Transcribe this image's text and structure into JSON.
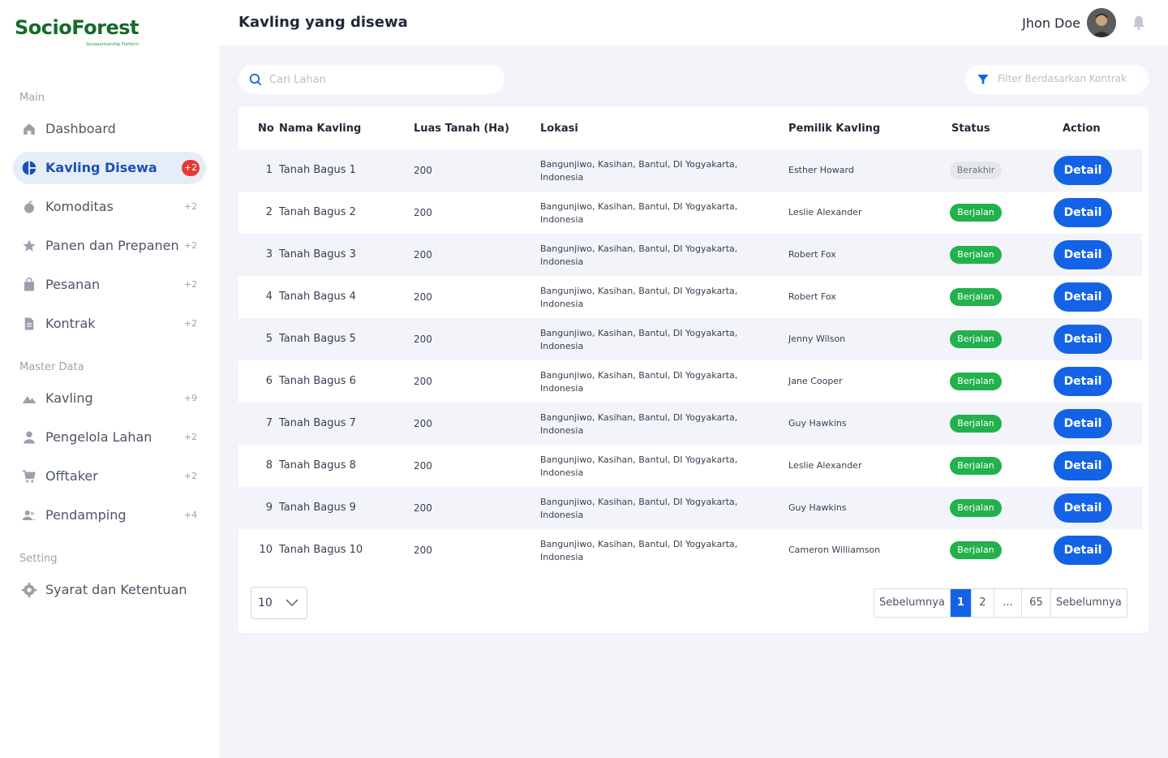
{
  "brand": {
    "name": "SocioForest",
    "tagline": "Sociopartnership Platform",
    "color": "#166b2a"
  },
  "sidebar": {
    "sections": [
      {
        "label": "Main"
      },
      {
        "label": "Master Data"
      },
      {
        "label": "Setting"
      }
    ],
    "items": [
      {
        "label": "Dashboard",
        "badge": "",
        "icon": "home-icon"
      },
      {
        "label": "Kavling Disewa",
        "badge": "+2",
        "icon": "pie-chart-icon",
        "active": true
      },
      {
        "label": "Komoditas",
        "badge": "+2",
        "icon": "fruit-icon"
      },
      {
        "label": "Panen dan Prepanen",
        "badge": "+2",
        "icon": "star-icon"
      },
      {
        "label": "Pesanan",
        "badge": "+2",
        "icon": "shopping-bag-icon"
      },
      {
        "label": "Kontrak",
        "badge": "+2",
        "icon": "document-icon"
      },
      {
        "label": "Kavling",
        "badge": "+9",
        "icon": "landscape-icon"
      },
      {
        "label": "Pengelola Lahan",
        "badge": "+2",
        "icon": "user-icon"
      },
      {
        "label": "Offtaker",
        "badge": "+2",
        "icon": "cart-icon"
      },
      {
        "label": "Pendamping",
        "badge": "+4",
        "icon": "users-icon"
      },
      {
        "label": "Syarat dan Ketentuan",
        "badge": "",
        "icon": "gear-icon"
      }
    ]
  },
  "header": {
    "title": "Kavling yang disewa",
    "user_name": "Jhon Doe"
  },
  "search": {
    "placeholder": "Cari Lahan",
    "value": ""
  },
  "filter": {
    "label": "Filter Berdasarkan Kontrak"
  },
  "table": {
    "headers": [
      "No",
      "Nama Kavling",
      "Luas Tanah (Ha)",
      "Lokasi",
      "Pemilik Kavling",
      "Status",
      "Action"
    ],
    "rows": [
      {
        "no": "1",
        "name": "Tanah Bagus 1",
        "luas": "200",
        "lokasi": "Bangunjiwo, Kasihan, Bantul, DI Yogyakarta, Indonesia",
        "owner": "Esther Howard",
        "status": "Berakhir",
        "action": "Detail"
      },
      {
        "no": "2",
        "name": "Tanah Bagus 2",
        "luas": "200",
        "lokasi": "Bangunjiwo, Kasihan, Bantul, DI Yogyakarta, Indonesia",
        "owner": "Leslie Alexander",
        "status": "Berjalan",
        "action": "Detail"
      },
      {
        "no": "3",
        "name": "Tanah Bagus 3",
        "luas": "200",
        "lokasi": "Bangunjiwo, Kasihan, Bantul, DI Yogyakarta, Indonesia",
        "owner": "Robert Fox",
        "status": "Berjalan",
        "action": "Detail"
      },
      {
        "no": "4",
        "name": "Tanah Bagus 4",
        "luas": "200",
        "lokasi": "Bangunjiwo, Kasihan, Bantul, DI Yogyakarta, Indonesia",
        "owner": "Robert Fox",
        "status": "Berjalan",
        "action": "Detail"
      },
      {
        "no": "5",
        "name": "Tanah Bagus 5",
        "luas": "200",
        "lokasi": "Bangunjiwo, Kasihan, Bantul, DI Yogyakarta, Indonesia",
        "owner": "Jenny Wilson",
        "status": "Berjalan",
        "action": "Detail"
      },
      {
        "no": "6",
        "name": "Tanah Bagus 6",
        "luas": "200",
        "lokasi": "Bangunjiwo, Kasihan, Bantul, DI Yogyakarta, Indonesia",
        "owner": "Jane Cooper",
        "status": "Berjalan",
        "action": "Detail"
      },
      {
        "no": "7",
        "name": "Tanah Bagus 7",
        "luas": "200",
        "lokasi": "Bangunjiwo, Kasihan, Bantul, DI Yogyakarta, Indonesia",
        "owner": "Guy Hawkins",
        "status": "Berjalan",
        "action": "Detail"
      },
      {
        "no": "8",
        "name": "Tanah Bagus 8",
        "luas": "200",
        "lokasi": "Bangunjiwo, Kasihan, Bantul, DI Yogyakarta, Indonesia",
        "owner": "Leslie Alexander",
        "status": "Berjalan",
        "action": "Detail"
      },
      {
        "no": "9",
        "name": "Tanah Bagus 9",
        "luas": "200",
        "lokasi": "Bangunjiwo, Kasihan, Bantul, DI Yogyakarta, Indonesia",
        "owner": "Guy Hawkins",
        "status": "Berjalan",
        "action": "Detail"
      },
      {
        "no": "10",
        "name": "Tanah Bagus 10",
        "luas": "200",
        "lokasi": "Bangunjiwo, Kasihan, Bantul, DI Yogyakarta, Indonesia",
        "owner": "Cameron Williamson",
        "status": "Berjalan",
        "action": "Detail"
      }
    ]
  },
  "pagination": {
    "page_size": "10",
    "prev_label": "Sebelumnya",
    "pages": [
      "1",
      "2",
      "...",
      "65"
    ],
    "current": "1",
    "next_label": "Sebelumnya"
  },
  "colors": {
    "primary": "#1463e6",
    "status_running": "#22b14c",
    "status_ended": "#e5e7eb",
    "badge_active": "#e53935",
    "active_nav_bg": "#e6edf9"
  }
}
